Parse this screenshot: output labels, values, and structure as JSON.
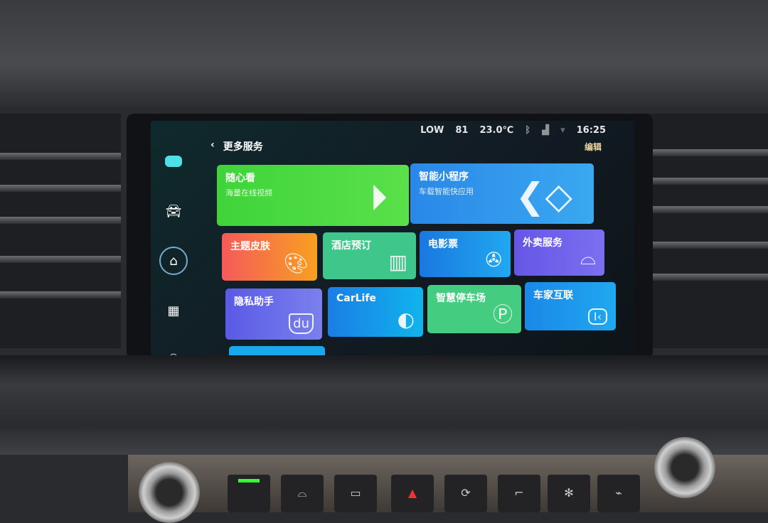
{
  "status": {
    "fan": "LOW",
    "seat": "81",
    "temp": "23.0℃",
    "time": "16:25"
  },
  "header": {
    "back": "‹",
    "title": "更多服务",
    "edit": "编辑"
  },
  "sidebar": [
    {
      "icon": "assistant-icon"
    },
    {
      "icon": "car-icon"
    },
    {
      "icon": "home-icon",
      "active": true
    },
    {
      "icon": "apps-icon"
    },
    {
      "icon": "user-icon"
    }
  ],
  "tiles": [
    {
      "title": "随心看",
      "subtitle": "海量在线视频",
      "icon": "play-icon",
      "color": "#3fd43a"
    },
    {
      "title": "智能小程序",
      "subtitle": "车载智能快应用",
      "icon": "mini-program-icon",
      "color": "#2a8ee8"
    },
    {
      "title": "主题皮肤",
      "icon": "palette-icon",
      "color": "#f5704a"
    },
    {
      "title": "酒店预订",
      "icon": "hotel-icon",
      "color": "#3fc68a"
    },
    {
      "title": "电影票",
      "icon": "film-reel-icon",
      "color": "#1a86e6"
    },
    {
      "title": "外卖服务",
      "icon": "cloche-icon",
      "color": "#6a5ce6"
    },
    {
      "title": "隐私助手",
      "icon": "du-shield-icon",
      "color": "#6a68e8"
    },
    {
      "title": "CarLife",
      "icon": "carlife-icon",
      "color": "#1a9ee8"
    },
    {
      "title": "智慧停车场",
      "icon": "parking-icon",
      "color": "#44cc80"
    },
    {
      "title": "车家互联",
      "icon": "car-home-link-icon",
      "color": "#1e90e8"
    }
  ]
}
